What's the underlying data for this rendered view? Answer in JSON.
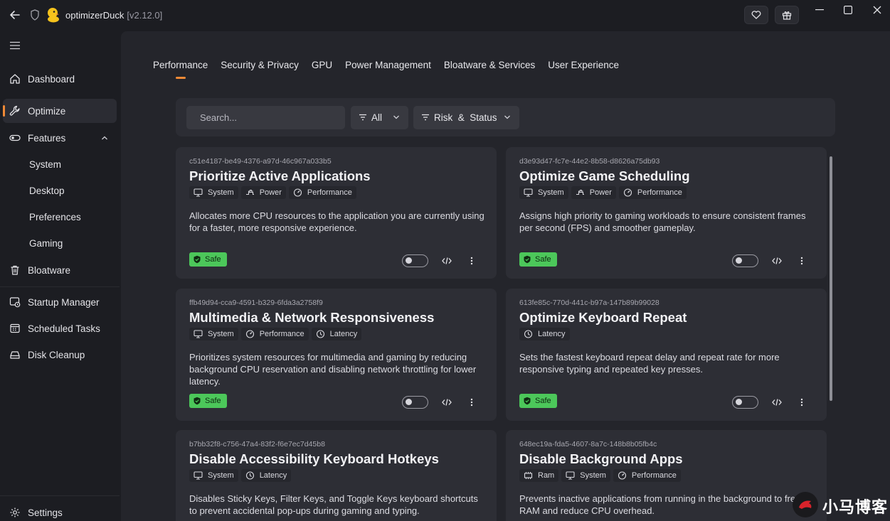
{
  "titlebar": {
    "app_name": "optimizerDuck",
    "version": "[v2.12.0]"
  },
  "sidebar": {
    "items": [
      {
        "label": "Dashboard",
        "icon": "home-icon"
      },
      {
        "label": "Optimize",
        "icon": "wrench-icon",
        "active": true
      },
      {
        "label": "Features",
        "icon": "toggle-icon",
        "expanded": true
      },
      {
        "label": "Bloatware",
        "icon": "trash-icon"
      },
      {
        "label": "Startup Manager",
        "icon": "startup-icon"
      },
      {
        "label": "Scheduled Tasks",
        "icon": "calendar-icon"
      },
      {
        "label": "Disk Cleanup",
        "icon": "disk-icon"
      }
    ],
    "feature_subitems": [
      "System",
      "Desktop",
      "Preferences",
      "Gaming"
    ],
    "settings_label": "Settings"
  },
  "tabs": [
    {
      "label": "Performance",
      "active": true
    },
    {
      "label": "Security & Privacy"
    },
    {
      "label": "GPU"
    },
    {
      "label": "Power Management"
    },
    {
      "label": "Bloatware & Services"
    },
    {
      "label": "User Experience"
    }
  ],
  "toolbar": {
    "search_placeholder": "Search...",
    "filter_all": "All",
    "filter_risk": "Risk  &  Status"
  },
  "cards": [
    {
      "id": "c51e4187-be49-4376-a97d-46c967a033b5",
      "title": "Prioritize Active Applications",
      "tags": [
        "System",
        "Power",
        "Performance"
      ],
      "description": "Allocates more CPU resources to the application you are currently using for a faster, more responsive experience.",
      "badge": "Safe"
    },
    {
      "id": "d3e93d47-fc7e-44e2-8b58-d8626a75db93",
      "title": "Optimize Game Scheduling",
      "tags": [
        "System",
        "Power",
        "Performance"
      ],
      "description": "Assigns high priority to gaming workloads to ensure consistent frames per second (FPS) and smoother gameplay.",
      "badge": "Safe"
    },
    {
      "id": "ffb49d94-cca9-4591-b329-6fda3a2758f9",
      "title": "Multimedia & Network Responsiveness",
      "tags": [
        "System",
        "Performance",
        "Latency"
      ],
      "description": "Prioritizes system resources for multimedia and gaming by reducing background CPU reservation and disabling network throttling for lower latency.",
      "badge": "Safe"
    },
    {
      "id": "613fe85c-770d-441c-b97a-147b89b99028",
      "title": "Optimize Keyboard Repeat",
      "tags": [
        "Latency"
      ],
      "description": "Sets the fastest keyboard repeat delay and repeat rate for more responsive typing and repeated key presses.",
      "badge": "Safe"
    },
    {
      "id": "b7bb32f8-c756-47a4-83f2-f6e7ec7d45b8",
      "title": "Disable Accessibility Keyboard Hotkeys",
      "tags": [
        "System",
        "Latency"
      ],
      "description": "Disables Sticky Keys, Filter Keys, and Toggle Keys keyboard shortcuts to prevent accidental pop-ups during gaming and typing."
    },
    {
      "id": "648ec19a-fda5-4607-8a7c-148b8b05fb4c",
      "title": "Disable Background Apps",
      "tags": [
        "Ram",
        "System",
        "Performance"
      ],
      "description": "Prevents inactive applications from running in the background to free up RAM and reduce CPU overhead."
    }
  ],
  "watermark": "小马博客",
  "colors": {
    "accent": "#f08a36",
    "safe_badge": "#4cc75a",
    "background": "#1c1d22",
    "card": "#2d2e35"
  }
}
